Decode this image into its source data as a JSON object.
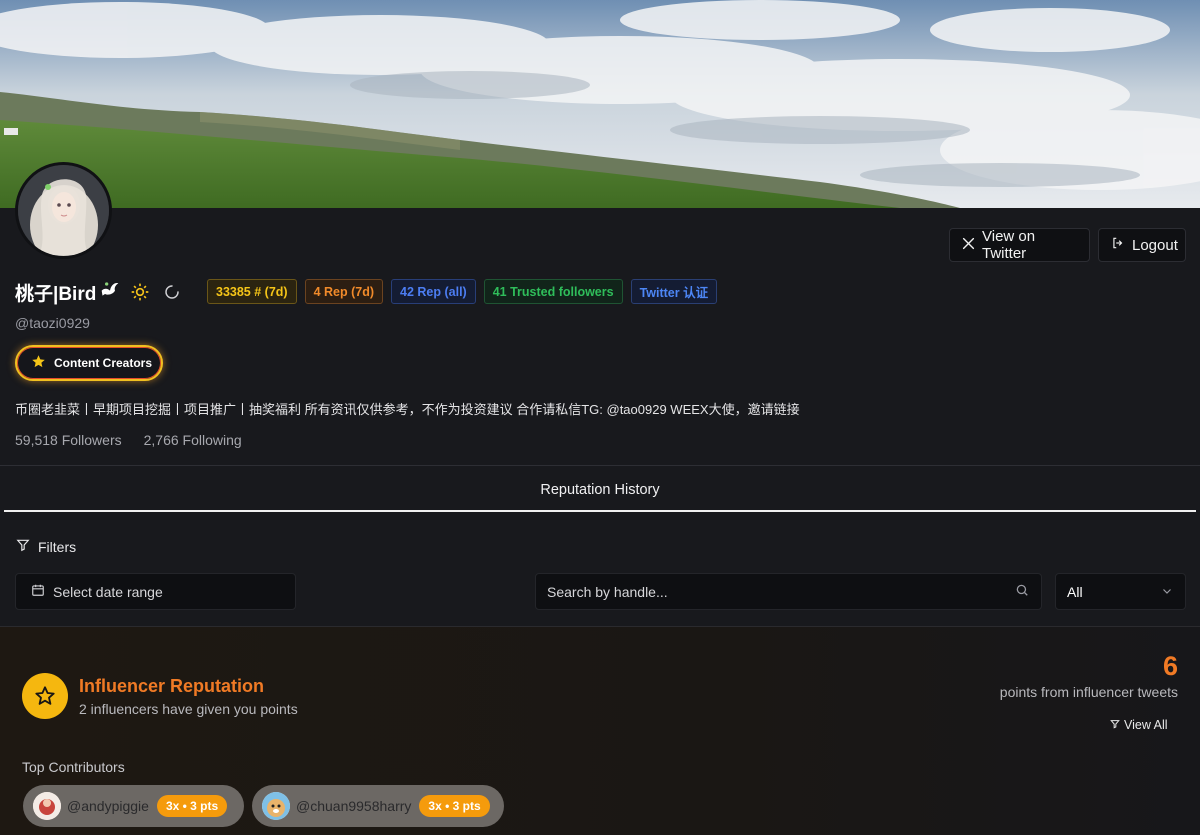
{
  "header": {
    "view_twitter": "View on Twitter",
    "logout": "Logout"
  },
  "profile": {
    "name": "桃子|Bird",
    "handle": "@taozi0929",
    "badges": [
      "33385 # (7d)",
      "4 Rep (7d)",
      "42 Rep (all)",
      "41 Trusted followers",
      "Twitter 认证"
    ],
    "category": "Content Creators",
    "bio": "币圈老韭菜丨早期项目挖掘丨项目推广丨抽奖福利 所有资讯仅供参考，不作为投资建议 合作请私信TG: @tao0929 WEEX大使，邀请链接",
    "followers": "59,518 Followers",
    "following": "2,766 Following"
  },
  "tabs": {
    "active": "Reputation History"
  },
  "filters": {
    "title": "Filters",
    "date_placeholder": "Select date range",
    "search_placeholder": "Search by handle...",
    "select_value": "All"
  },
  "influencer": {
    "title": "Influencer Reputation",
    "subtitle": "2 influencers have given you points",
    "points": "6",
    "points_label": "points from influencer tweets",
    "view_all": "View All",
    "top_contributors_label": "Top Contributors",
    "contributors": [
      {
        "handle": "@andypiggie",
        "badge": "3x • 3 pts"
      },
      {
        "handle": "@chuan9958harry",
        "badge": "3x • 3 pts"
      }
    ]
  },
  "colors": {
    "accent_orange": "#f07a25",
    "star_yellow": "#f5b70f",
    "page_bg": "#18191d"
  }
}
